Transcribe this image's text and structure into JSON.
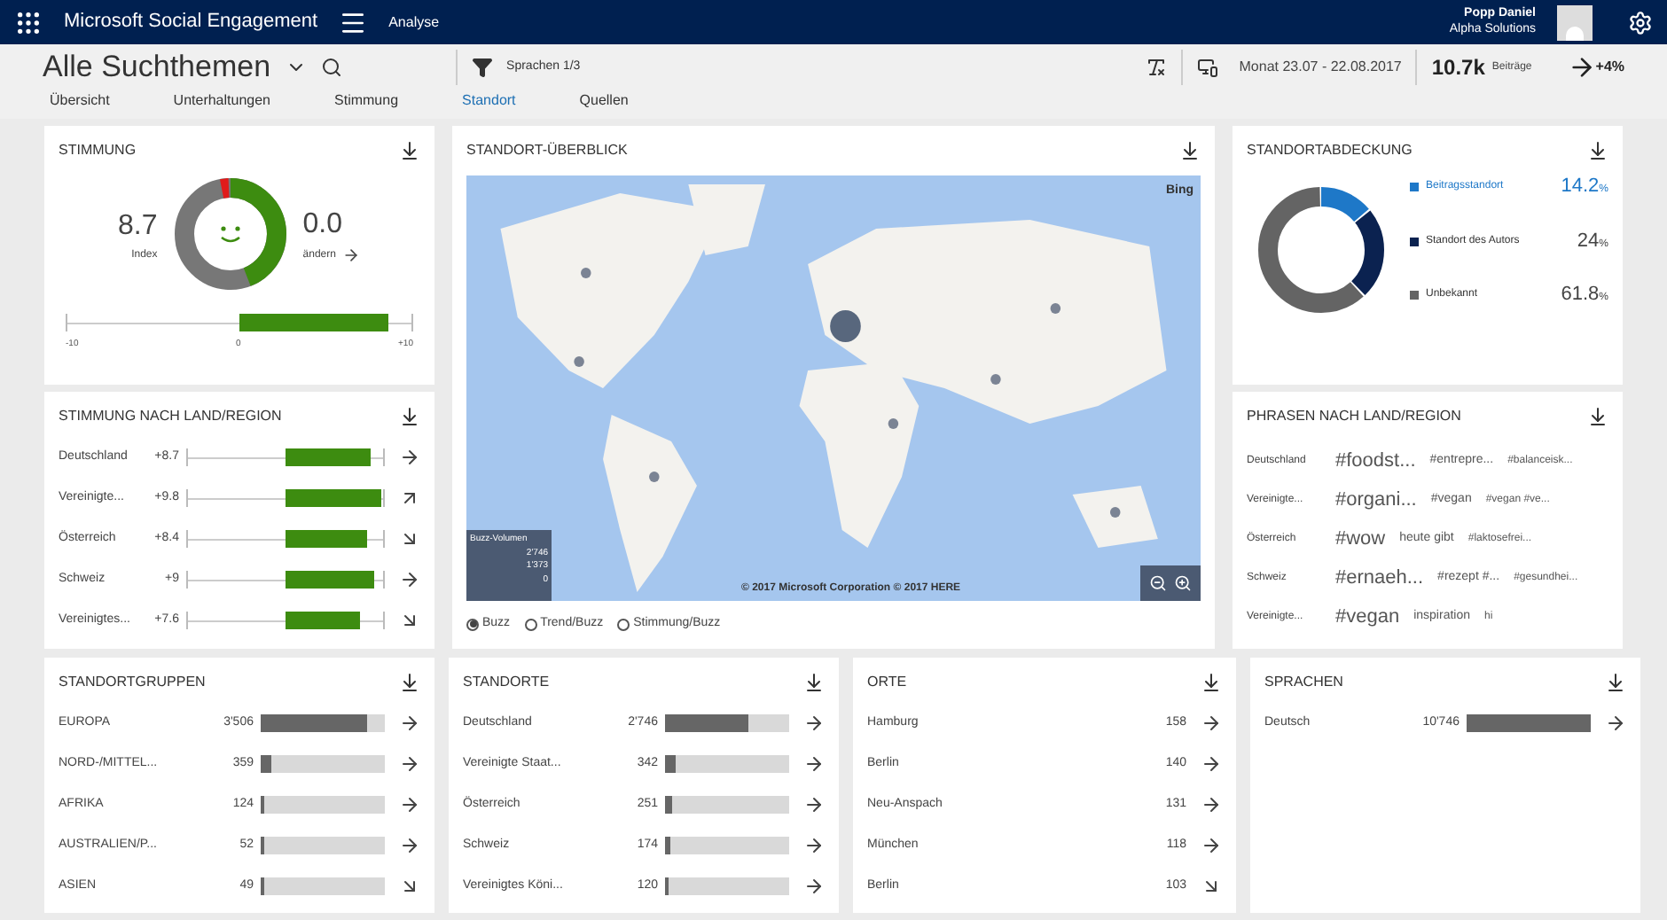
{
  "top_bar": {
    "app_title": "Microsoft Social Engagement",
    "nav_label": "Analyse",
    "user_name": "Popp Daniel",
    "org": "Alpha Solutions"
  },
  "header": {
    "title": "Alle Suchthemen",
    "filter": "Sprachen 1/3",
    "date": "Monat 23.07 - 22.08.2017",
    "count": "10.7k",
    "count_label": "Beiträge",
    "trend": "+4%"
  },
  "tabs": [
    {
      "label": "Übersicht",
      "selected": false
    },
    {
      "label": "Unterhaltungen",
      "selected": false
    },
    {
      "label": "Stimmung",
      "selected": false
    },
    {
      "label": "Standort",
      "selected": true
    },
    {
      "label": "Quellen",
      "selected": false
    }
  ],
  "sentiment": {
    "title": "STIMMUNG",
    "index": "8.7",
    "index_label": "Index",
    "change": "0.0",
    "change_label": "ändern",
    "scale": {
      "level": 0.87,
      "ticks": [
        "-10",
        "0",
        "+10"
      ]
    }
  },
  "sentiment_by_region": {
    "title": "STIMMUNG NACH LAND/REGION",
    "rows": [
      {
        "name": "Deutschland",
        "value": "+8.7",
        "level": 0.87,
        "kind": "flat"
      },
      {
        "name": "Vereinigte...",
        "value": "+9.8",
        "level": 0.98,
        "kind": "up"
      },
      {
        "name": "Österreich",
        "value": "+8.4",
        "level": 0.84,
        "kind": "down"
      },
      {
        "name": "Schweiz",
        "value": "+9",
        "level": 0.9,
        "kind": "flat"
      },
      {
        "name": "Vereinigtes...",
        "value": "+7.6",
        "level": 0.76,
        "kind": "down"
      }
    ]
  },
  "map": {
    "title": "STANDORT-ÜBERBLICK",
    "logo": "Bing",
    "legend_title": "Buzz-Volumen",
    "legend_values": [
      "2'746",
      "1'373",
      "0"
    ],
    "copyright": "© 2017 Microsoft Corporation © 2017 HERE",
    "modes": [
      {
        "label": "Buzz",
        "selected": true
      },
      {
        "label": "Trend/Buzz",
        "selected": false
      },
      {
        "label": "Stimmung/Buzz",
        "selected": false
      }
    ]
  },
  "coverage": {
    "title": "STANDORTABDECKUNG",
    "items": [
      {
        "label": "Beitragsstandort",
        "value": "14.2",
        "unit": "%",
        "color": "#1e78c8"
      },
      {
        "label": "Standort des Autors",
        "value": "24",
        "unit": "%",
        "color": "#0b2250"
      },
      {
        "label": "Unbekannt",
        "value": "61.8",
        "unit": "%",
        "color": "#646464"
      }
    ]
  },
  "phrases": {
    "title": "PHRASEN NACH LAND/REGION",
    "rows": [
      {
        "country": "Deutschland",
        "phrases": [
          "#foodst...",
          "#entrepre...",
          "#balanceisk..."
        ]
      },
      {
        "country": "Vereinigte...",
        "phrases": [
          "#organi...",
          "#vegan",
          "#vegan #ve..."
        ]
      },
      {
        "country": "Österreich",
        "phrases": [
          "#wow",
          "heute gibt",
          "#laktosefrei..."
        ]
      },
      {
        "country": "Schweiz",
        "phrases": [
          "#ernaeh...",
          "#rezept #...",
          "#gesundhei..."
        ]
      },
      {
        "country": "Vereinigte...",
        "phrases": [
          "#vegan",
          "inspiration",
          "hi"
        ]
      }
    ]
  },
  "location_groups": {
    "title": "STANDORTGRUPPEN",
    "rows": [
      {
        "name": "EUROPA",
        "count": "3'506",
        "level": 0.85,
        "kind": "flat"
      },
      {
        "name": "NORD-/MITTEL...",
        "count": "359",
        "level": 0.09,
        "kind": "flat"
      },
      {
        "name": "AFRIKA",
        "count": "124",
        "level": 0.03,
        "kind": "flat"
      },
      {
        "name": "AUSTRALIEN/P...",
        "count": "52",
        "level": 0.01,
        "kind": "flat"
      },
      {
        "name": "ASIEN",
        "count": "49",
        "level": 0.01,
        "kind": "down"
      }
    ]
  },
  "locations": {
    "title": "STANDORTE",
    "rows": [
      {
        "name": "Deutschland",
        "count": "2'746",
        "level": 0.67,
        "kind": "flat"
      },
      {
        "name": "Vereinigte Staat...",
        "count": "342",
        "level": 0.08,
        "kind": "flat"
      },
      {
        "name": "Österreich",
        "count": "251",
        "level": 0.06,
        "kind": "flat"
      },
      {
        "name": "Schweiz",
        "count": "174",
        "level": 0.04,
        "kind": "flat"
      },
      {
        "name": "Vereinigtes Köni...",
        "count": "120",
        "level": 0.03,
        "kind": "flat"
      }
    ]
  },
  "places": {
    "title": "ORTE",
    "rows": [
      {
        "name": "Hamburg",
        "count": "158",
        "kind": "flat"
      },
      {
        "name": "Berlin",
        "count": "140",
        "kind": "flat"
      },
      {
        "name": "Neu-Anspach",
        "count": "131",
        "kind": "flat"
      },
      {
        "name": "München",
        "count": "118",
        "kind": "flat"
      },
      {
        "name": "Berlin",
        "count": "103",
        "kind": "down"
      }
    ]
  },
  "languages": {
    "title": "SPRACHEN",
    "rows": [
      {
        "name": "Deutsch",
        "count": "10'746",
        "level": 1,
        "kind": "flat"
      }
    ]
  }
}
